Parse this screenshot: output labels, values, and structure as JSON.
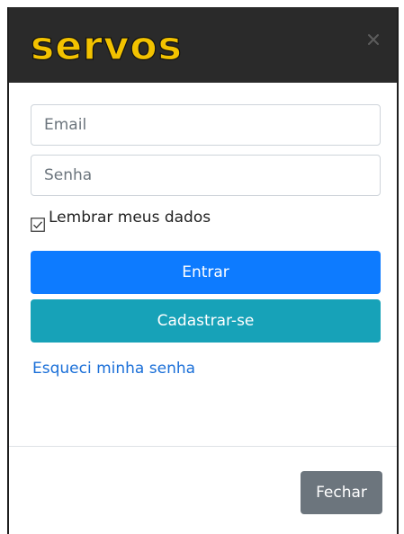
{
  "header": {
    "logo_text": "servos",
    "logo_color": "#f2c200",
    "background": "#2a2a2a",
    "close_icon": "close-icon"
  },
  "form": {
    "email": {
      "placeholder": "Email",
      "value": ""
    },
    "password": {
      "placeholder": "Senha",
      "value": ""
    },
    "remember": {
      "label": "Lembrar meus dados",
      "checked": false
    },
    "login_button": {
      "label": "Entrar",
      "color": "#0d7bff"
    },
    "register_button": {
      "label": "Cadastrar-se",
      "color": "#17a2b8"
    },
    "forgot_link": {
      "label": "Esqueci minha senha",
      "color": "#1a6fd8"
    }
  },
  "footer": {
    "close_button": {
      "label": "Fechar",
      "color": "#6c757d"
    }
  }
}
